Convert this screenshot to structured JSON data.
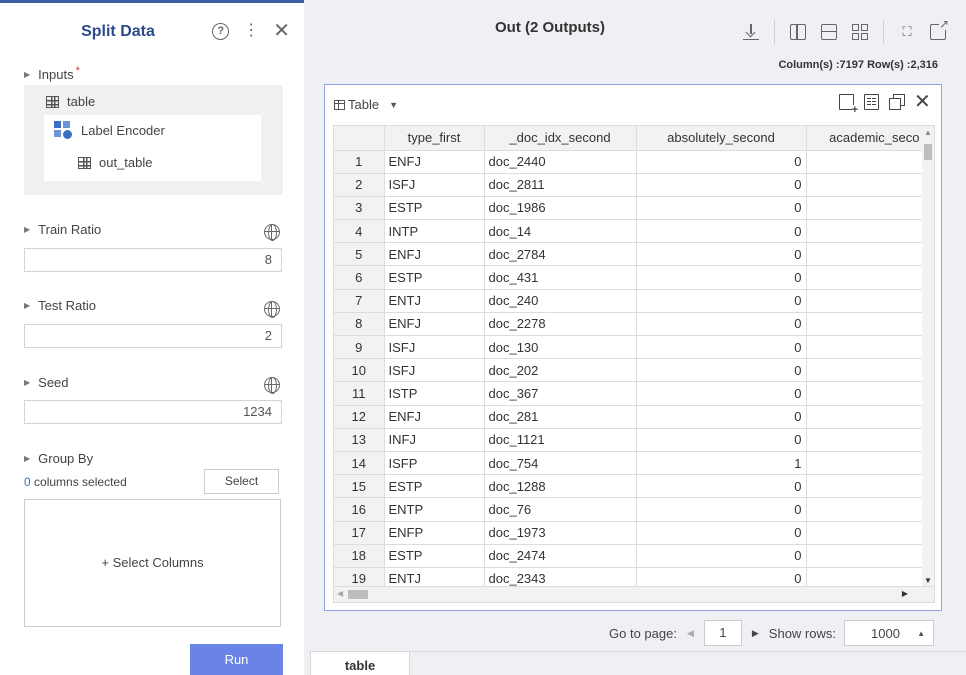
{
  "left_panel": {
    "title": "Split Data",
    "inputs": {
      "label": "Inputs",
      "required_mark": "*",
      "table_name": "table",
      "encoder_name": "Label Encoder",
      "out_name": "out_table"
    },
    "train_ratio": {
      "label": "Train Ratio",
      "value": "8"
    },
    "test_ratio": {
      "label": "Test Ratio",
      "value": "2"
    },
    "seed": {
      "label": "Seed",
      "value": "1234"
    },
    "group_by": {
      "label": "Group By",
      "count": "0",
      "count_text": "columns selected",
      "select_label": "Select",
      "select_columns_label": "+ Select Columns"
    },
    "run_label": "Run"
  },
  "right_panel": {
    "title": "Out (2 Outputs)",
    "column_row_count": "Column(s) :7197  Row(s) :2,316",
    "table_view_label": "Table",
    "columns": [
      "type_first",
      "_doc_idx_second",
      "absolutely_second",
      "academic_seco"
    ],
    "rows": [
      [
        "1",
        "ENFJ",
        "doc_2440",
        "0"
      ],
      [
        "2",
        "ISFJ",
        "doc_2811",
        "0"
      ],
      [
        "3",
        "ESTP",
        "doc_1986",
        "0"
      ],
      [
        "4",
        "INTP",
        "doc_14",
        "0"
      ],
      [
        "5",
        "ENFJ",
        "doc_2784",
        "0"
      ],
      [
        "6",
        "ESTP",
        "doc_431",
        "0"
      ],
      [
        "7",
        "ENTJ",
        "doc_240",
        "0"
      ],
      [
        "8",
        "ENFJ",
        "doc_2278",
        "0"
      ],
      [
        "9",
        "ISFJ",
        "doc_130",
        "0"
      ],
      [
        "10",
        "ISFJ",
        "doc_202",
        "0"
      ],
      [
        "11",
        "ISTP",
        "doc_367",
        "0"
      ],
      [
        "12",
        "ENFJ",
        "doc_281",
        "0"
      ],
      [
        "13",
        "INFJ",
        "doc_1121",
        "0"
      ],
      [
        "14",
        "ISFP",
        "doc_754",
        "1"
      ],
      [
        "15",
        "ESTP",
        "doc_1288",
        "0"
      ],
      [
        "16",
        "ENTP",
        "doc_76",
        "0"
      ],
      [
        "17",
        "ENFP",
        "doc_1973",
        "0"
      ],
      [
        "18",
        "ESTP",
        "doc_2474",
        "0"
      ],
      [
        "19",
        "ENTJ",
        "doc_2343",
        "0"
      ]
    ],
    "pager": {
      "goto_label": "Go to page:",
      "page": "1",
      "show_rows_label": "Show rows:",
      "rows_per_page": "1000"
    },
    "bottom_tab": "table"
  },
  "colors": {
    "accent": "#3f5fa3",
    "run_button": "#6a83e6",
    "panel_border": "#8ea4e6"
  }
}
